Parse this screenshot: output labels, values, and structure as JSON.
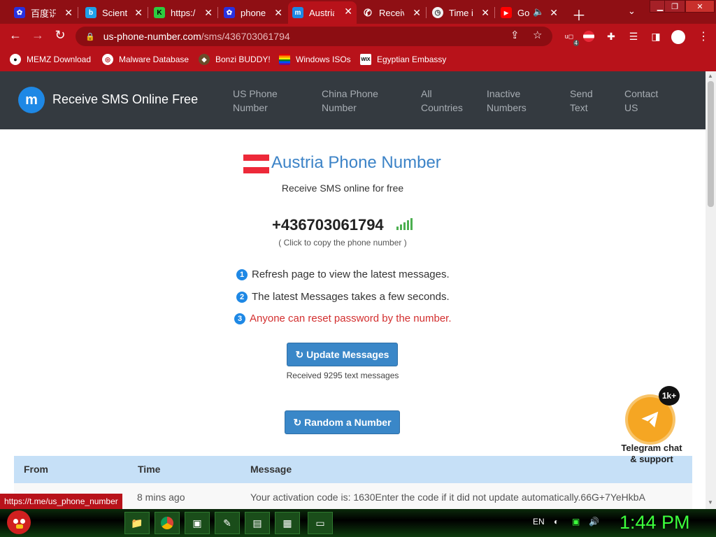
{
  "browser": {
    "tabs": [
      {
        "title": "百度识",
        "icon": "baidu-icon",
        "color": "#2932e1"
      },
      {
        "title": "Scient",
        "icon": "bing-icon",
        "color": "#1fa0e8"
      },
      {
        "title": "https:/",
        "icon": "k-icon",
        "color": "#2ecc40"
      },
      {
        "title": "phone",
        "icon": "baidu-icon",
        "color": "#2932e1"
      },
      {
        "title": "Austria",
        "icon": "site-logo-icon",
        "color": "#1e88e5",
        "active": true
      },
      {
        "title": "Receiv",
        "icon": "phone-icon",
        "color": "#b8121a"
      },
      {
        "title": "Time i",
        "icon": "clock-icon",
        "color": "#f0f0f0"
      },
      {
        "title": "Go",
        "icon": "youtube-icon",
        "color": "#ff0000"
      }
    ],
    "url_host": "us-phone-number.com",
    "url_path": "/sms/436703061794",
    "bookmarks": [
      {
        "label": "MEMZ Download",
        "icon": "github-icon"
      },
      {
        "label": "Malware Database",
        "icon": "globe-icon"
      },
      {
        "label": "Bonzi BUDDY!",
        "icon": "bonzi-icon"
      },
      {
        "label": "Windows ISOs",
        "icon": "windows-flag-icon"
      },
      {
        "label": "Egyptian Embassy",
        "icon": "wix-icon"
      }
    ],
    "extension_badge": "4",
    "status_link": "https://t.me/us_phone_number"
  },
  "site": {
    "logo_letter": "m",
    "brand": "Receive SMS Online Free",
    "nav": [
      "US Phone\nNumber",
      "China Phone\nNumber",
      "All\nCountries",
      "Inactive\nNumbers",
      "Send\nText",
      "Contact\nUS"
    ],
    "title": "Austria Phone Number",
    "subtitle": "Receive SMS online for free",
    "phone": "+436703061794",
    "copy_hint": "( Click to copy the phone number )",
    "steps": [
      {
        "num": "1",
        "text": "Refresh page to view the latest messages."
      },
      {
        "num": "2",
        "text": "The latest Messages takes a few seconds."
      },
      {
        "num": "3",
        "text": "Anyone can reset password by the number."
      }
    ],
    "update_button": "↻ Update Messages",
    "received": "Received 9295 text messages",
    "random_button": "↻ Random a Number",
    "table": {
      "headers": [
        "From",
        "Time",
        "Message"
      ],
      "rows": [
        {
          "from": "",
          "time": "8 mins ago",
          "message": "Your activation code is: 1630Enter the code if it did not update automatically.66G+7YeHkbA"
        }
      ]
    },
    "telegram": {
      "badge": "1k+",
      "label": "Telegram chat\n& support"
    }
  },
  "taskbar": {
    "lang": "EN",
    "clock": "1:44 PM"
  },
  "colors": {
    "browser_red": "#b8121a",
    "header_dark": "#343a40",
    "title_blue": "#3c83c7",
    "warn_red": "#d32f2f",
    "clock_green": "#3cff3c"
  }
}
